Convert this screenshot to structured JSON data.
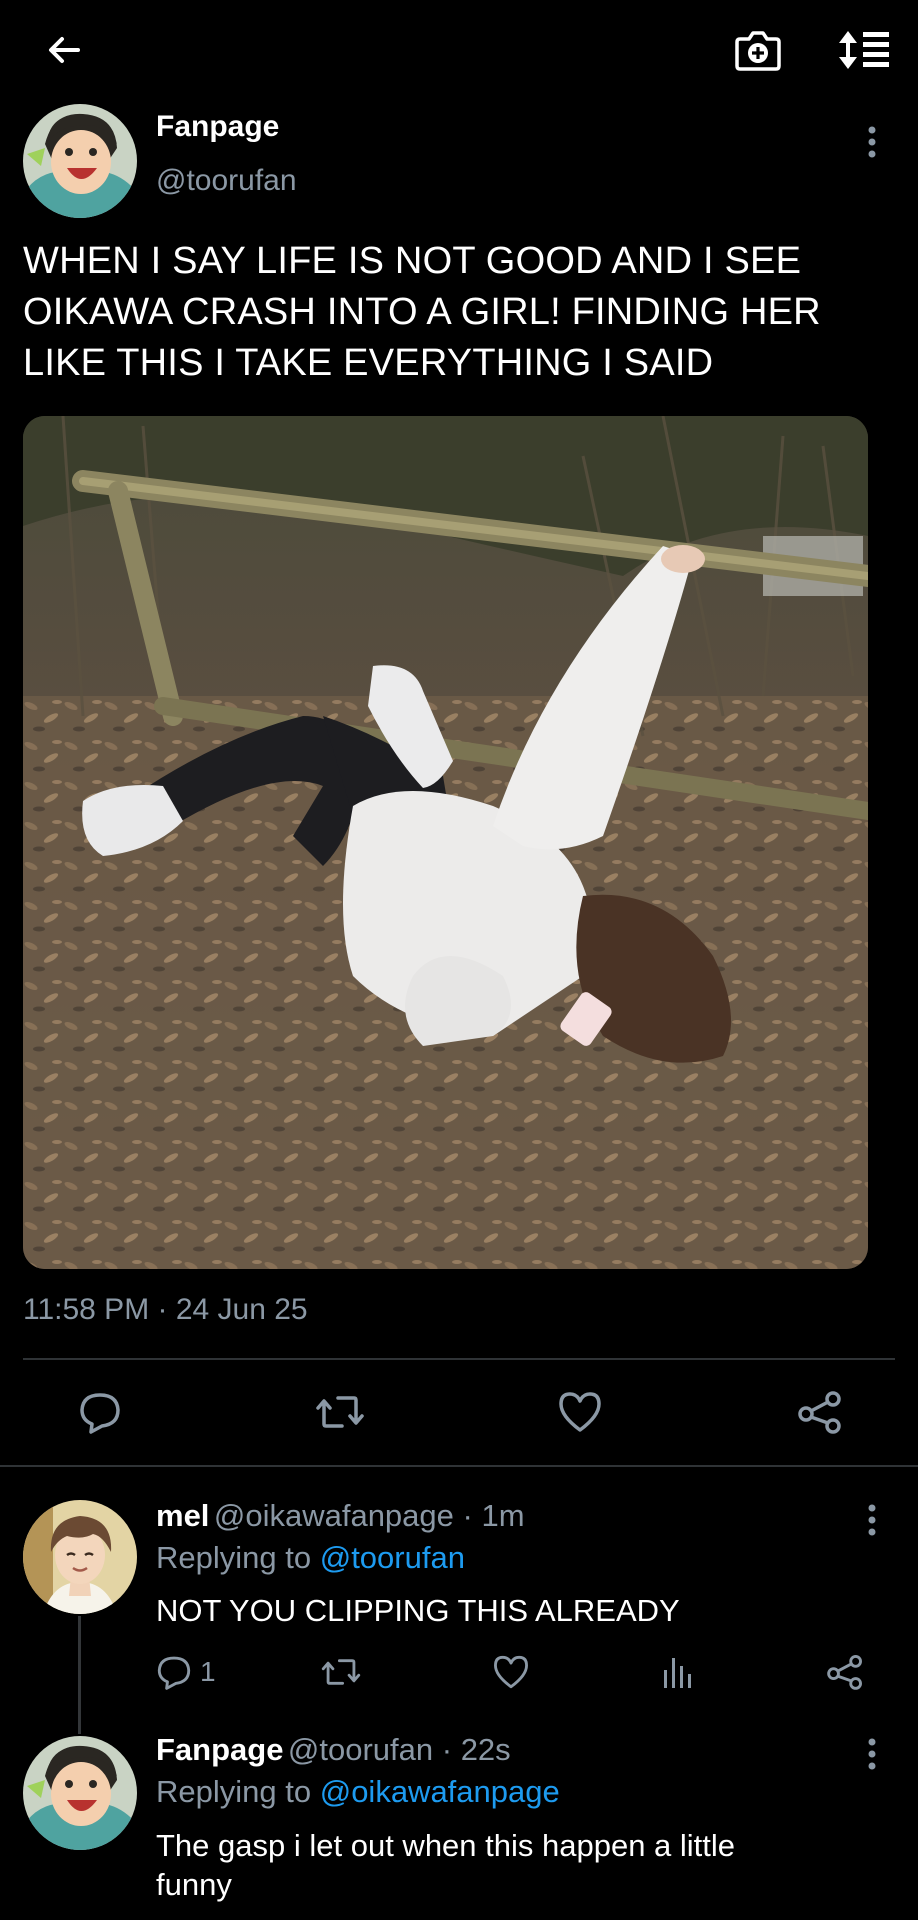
{
  "topbar": {
    "back_icon": "arrow-left-icon",
    "camera_icon": "camera-plus-icon",
    "sort_icon": "sort-list-icon"
  },
  "main_post": {
    "name": "Fanpage",
    "handle": "@toorufan",
    "text_lines": [
      "WHEN I SAY LIFE IS NOT GOOD AND I SEE",
      "OIKAWA CRASH INTO A GIRL! FINDING HER",
      "LIKE THIS I TAKE EVERYTHING I SAID"
    ],
    "timestamp": "11:58 PM · 24 Jun 25",
    "actions": [
      "reply-icon",
      "retweet-icon",
      "like-icon",
      "share-icon"
    ]
  },
  "replies": [
    {
      "name": "mel",
      "meta": "@oikawafanpage · 1m",
      "replying_prefix": "Replying to",
      "replying_to": "@toorufan",
      "text": "NOT YOU CLIPPING THIS ALREADY",
      "reply_count": "1",
      "actions": [
        "reply-icon",
        "retweet-icon",
        "like-icon",
        "analytics-icon",
        "share-icon"
      ]
    },
    {
      "name": "Fanpage",
      "meta": "@toorufan · 22s",
      "replying_prefix": "Replying to",
      "replying_to": "@oikawafanpage",
      "text_lines": [
        "The gasp i let out when this happen a little",
        "funny"
      ]
    }
  ],
  "colors": {
    "background": "#000000",
    "secondary_text": "#8b98a5",
    "link": "#1d9bf0",
    "divider": "#2f3336"
  }
}
